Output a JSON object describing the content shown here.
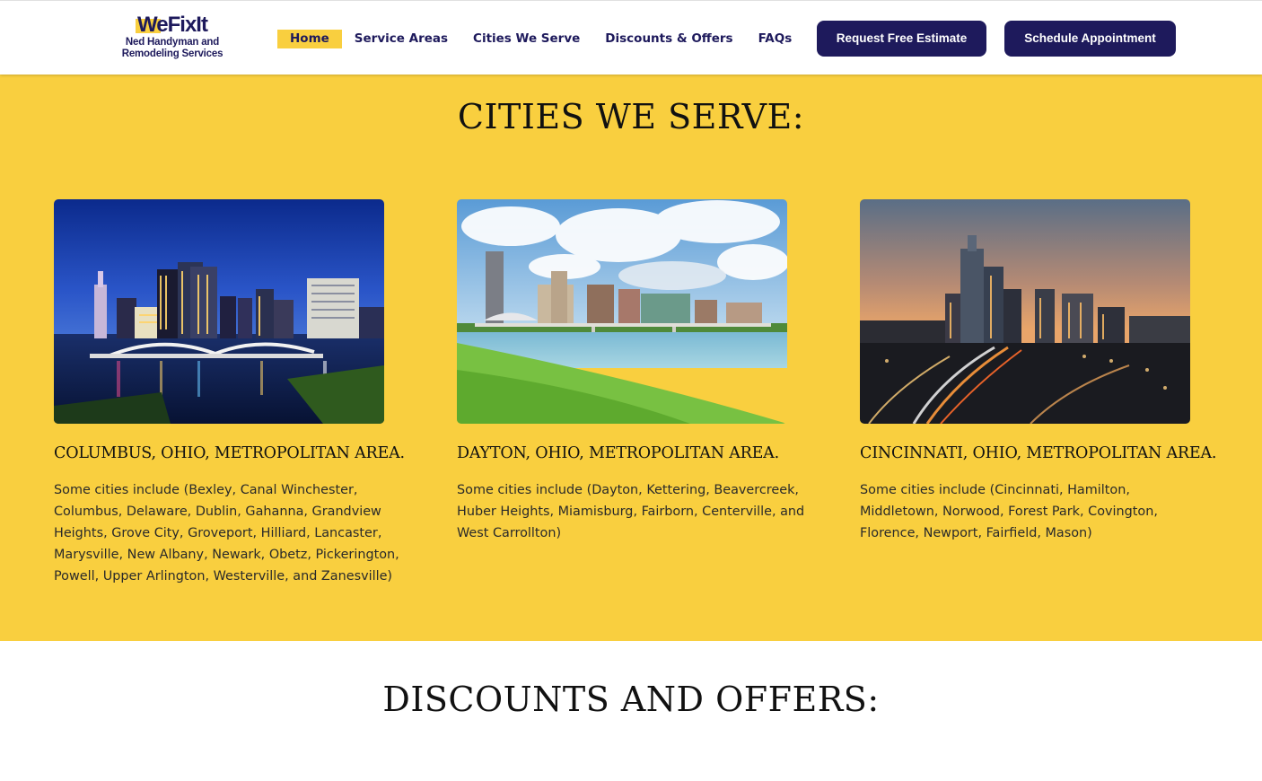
{
  "header": {
    "logo": {
      "mark": "WeFixIt",
      "line1": "Ned Handyman and",
      "line2": "Remodeling Services"
    },
    "nav": [
      {
        "label": "Home",
        "active": true
      },
      {
        "label": "Service Areas",
        "active": false
      },
      {
        "label": "Cities We Serve",
        "active": false
      },
      {
        "label": "Discounts & Offers",
        "active": false
      },
      {
        "label": "FAQs",
        "active": false
      }
    ],
    "buttons": {
      "estimate": "Request Free Estimate",
      "schedule": "Schedule Appointment"
    }
  },
  "cities_section": {
    "title": "CITIES WE SERVE:",
    "cards": [
      {
        "image": "columbus-skyline-night",
        "title": "COLUMBUS, OHIO, METROPOLITAN AREA.",
        "text": "Some cities include (Bexley, Canal Winchester, Columbus, Delaware, Dublin, Gahanna, Grandview Heights, Grove City, Groveport, Hilliard, Lancaster, Marysville, New Albany, Newark, Obetz, Pickerington, Powell, Upper Arlington, Westerville, and Zanesville)"
      },
      {
        "image": "dayton-skyline-river",
        "title": "DAYTON, OHIO, METROPOLITAN AREA.",
        "text": "Some cities include (Dayton, Kettering, Beavercreek, Huber Heights, Miamisburg, Fairborn, Centerville, and West Carrollton)"
      },
      {
        "image": "cincinnati-skyline-dusk",
        "title": "CINCINNATI, OHIO, METROPOLITAN AREA.",
        "text": "Some cities include (Cincinnati, Hamilton, Middletown, Norwood, Forest Park, Covington, Florence, Newport, Fairfield, Mason)"
      }
    ]
  },
  "discounts_section": {
    "title": "DISCOUNTS AND OFFERS:"
  },
  "colors": {
    "accent": "#f9cf3f",
    "brand": "#1e1a5c",
    "text": "#111111"
  }
}
